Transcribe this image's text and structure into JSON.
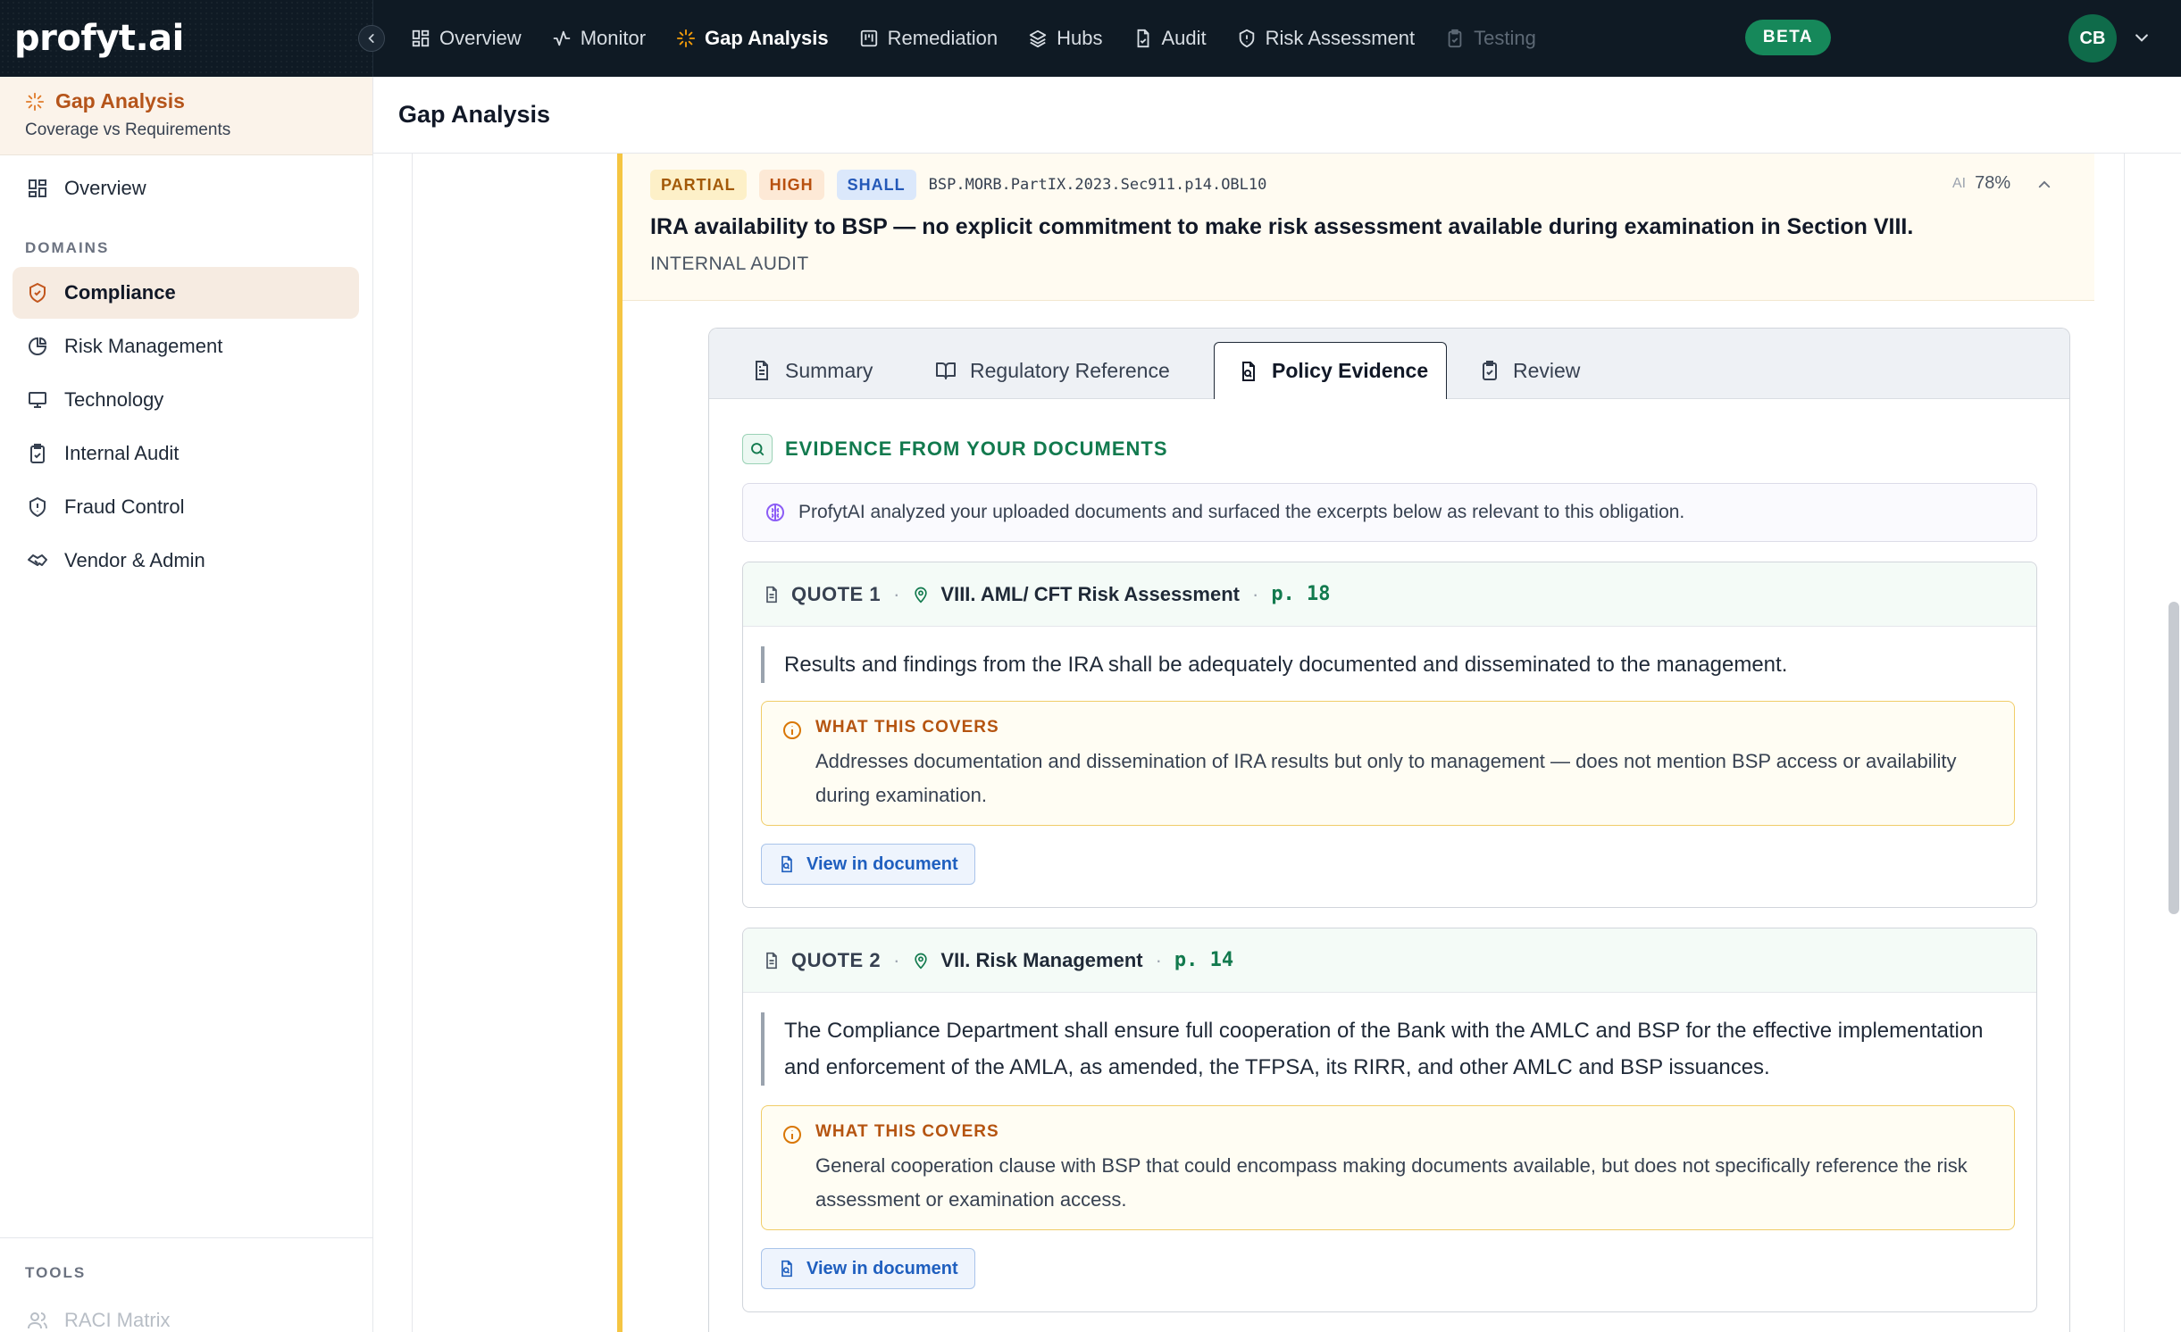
{
  "topbar": {
    "logo": "profyt.ai",
    "nav": [
      {
        "label": "Overview",
        "icon": "grid-icon"
      },
      {
        "label": "Monitor",
        "icon": "activity-icon"
      },
      {
        "label": "Gap Analysis",
        "icon": "sparkle-icon"
      },
      {
        "label": "Remediation",
        "icon": "kanban-icon"
      },
      {
        "label": "Hubs",
        "icon": "layers-icon"
      },
      {
        "label": "Audit",
        "icon": "file-check-icon"
      },
      {
        "label": "Risk Assessment",
        "icon": "shield-icon"
      },
      {
        "label": "Testing",
        "icon": "clipboard-icon"
      }
    ],
    "active_nav": "Gap Analysis",
    "beta": "BETA",
    "avatar": "CB"
  },
  "sidebar": {
    "title": "Gap Analysis",
    "subtitle": "Coverage vs Requirements",
    "overview": "Overview",
    "domains_label": "DOMAINS",
    "domains": [
      {
        "label": "Compliance",
        "icon": "shield-check-icon",
        "active": true
      },
      {
        "label": "Risk Management",
        "icon": "pie-chart-icon"
      },
      {
        "label": "Technology",
        "icon": "monitor-icon"
      },
      {
        "label": "Internal Audit",
        "icon": "clipboard-check-icon"
      },
      {
        "label": "Fraud Control",
        "icon": "shield-alert-icon"
      },
      {
        "label": "Vendor & Admin",
        "icon": "handshake-icon"
      }
    ],
    "tools_label": "TOOLS",
    "tools": [
      {
        "label": "RACI Matrix",
        "icon": "users-icon"
      }
    ]
  },
  "page": {
    "title": "Gap Analysis"
  },
  "obligation": {
    "badges": [
      "PARTIAL",
      "HIGH",
      "SHALL"
    ],
    "ref": "BSP.MORB.PartIX.2023.Sec911.p14.OBL10",
    "ai_label": "AI",
    "ai_confidence": "78%",
    "title": "IRA availability to BSP — no explicit commitment to make risk assessment available during examination in Section VIII.",
    "domain": "INTERNAL AUDIT"
  },
  "tabs": [
    {
      "label": "Summary",
      "icon": "file-text-icon"
    },
    {
      "label": "Regulatory Reference",
      "icon": "book-open-icon"
    },
    {
      "label": "Policy Evidence",
      "icon": "file-search-icon"
    },
    {
      "label": "Review",
      "icon": "clipboard-check-icon"
    }
  ],
  "active_tab": "Policy Evidence",
  "evidence": {
    "title": "EVIDENCE FROM YOUR DOCUMENTS",
    "note": "ProfytAI analyzed your uploaded documents and surfaced the excerpts below as relevant to this obligation.",
    "quotes": [
      {
        "label": "QUOTE 1",
        "section": "VIII. AML/ CFT Risk Assessment",
        "page": "p. 18",
        "text": "Results and findings from the IRA shall be adequately documented and disseminated to the management.",
        "covers_title": "WHAT THIS COVERS",
        "covers_text": "Addresses documentation and dissemination of IRA results but only to management — does not mention BSP access or availability during examination.",
        "button": "View in document"
      },
      {
        "label": "QUOTE 2",
        "section": "VII. Risk Management",
        "page": "p. 14",
        "text": "The Compliance Department shall ensure full cooperation of the Bank with the AMLC and BSP for the effective implementation and enforcement of the AMLA, as amended, the TFPSA, its RIRR, and other AMLC and BSP issuances.",
        "covers_title": "WHAT THIS COVERS",
        "covers_text": "General cooperation clause with BSP that could encompass making documents available, but does not specifically reference the risk assessment or examination access.",
        "button": "View in document"
      }
    ]
  },
  "colors": {
    "topbar_bg": "#0f1a24",
    "accent_orange": "#b5541a",
    "beta_green": "#16885a",
    "evidence_green": "#127a4e",
    "partial_bg": "#fdf0c8",
    "obligation_accent": "#f5c542"
  }
}
